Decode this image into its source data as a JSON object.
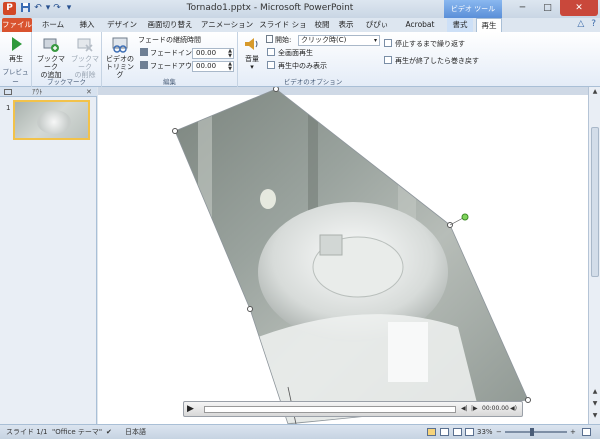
{
  "titlebar": {
    "app_icon": "P",
    "qat_save_icon": "save-icon",
    "qat_undo_icon": "undo-icon",
    "qat_redo_icon": "redo-icon",
    "qat_customize_icon": "chevron-down-icon",
    "title": "Tornado1.pptx  -  Microsoft PowerPoint",
    "context_tab_header": "ビデオ ツール",
    "minimize": "─",
    "maximize": "□",
    "close": "✕"
  },
  "tabs": [
    "ファイル",
    "ホーム",
    "挿入",
    "デザイン",
    "画面切り替え",
    "アニメーション",
    "スライド ショー",
    "校閲",
    "表示",
    "ぴぴぃ",
    "Acrobat",
    "書式",
    "再生"
  ],
  "help": {
    "collapse": "△",
    "help": "?"
  },
  "ribbon": {
    "preview": {
      "label": "プレビュー",
      "play": "再生"
    },
    "bookmarks": {
      "label": "ブックマーク",
      "add_line1": "ブックマーク",
      "add_line2": "の追加",
      "remove_line1": "ブックマーク",
      "remove_line2": "の削除"
    },
    "edit": {
      "label": "編集",
      "trim_line1": "ビデオの",
      "trim_line2": "トリミング",
      "fade_heading": "フェードの継続時間",
      "fade_in_label": "フェードイン:",
      "fade_in_value": "00.00",
      "fade_out_label": "フェードアウト:",
      "fade_out_value": "00.00"
    },
    "video_options": {
      "label": "ビデオのオプション",
      "volume": "音量",
      "start_label": "開始:",
      "start_value": "クリック時(C)",
      "fullscreen": "全画面再生",
      "hide_not_playing": "再生中のみ表示",
      "loop": "停止するまで繰り返す",
      "rewind": "再生が終了したら巻き戻す"
    }
  },
  "panel": {
    "tab_slides_icon": "slides-tab-icon",
    "tab_outline": "ｱｳﾄ",
    "close": "✕",
    "slide_number": "1"
  },
  "video_controls": {
    "time": "00:00.00"
  },
  "status": {
    "slide": "スライド 1/1",
    "theme": "\"Office テーマ\"",
    "language": "日本語",
    "zoom": "33%",
    "zoom_out": "−",
    "zoom_in": "+"
  }
}
